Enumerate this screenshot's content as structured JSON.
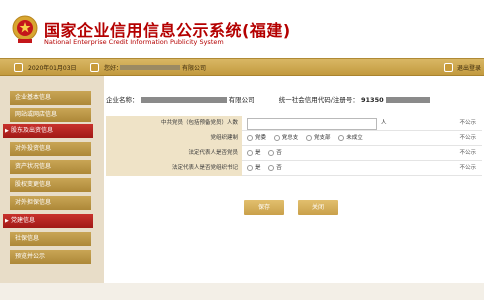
{
  "header": {
    "title_cn": "国家企业信用信息公示系统",
    "title_region": "(福建)",
    "title_en": "National Enterprise Credit Information Publicity System"
  },
  "toolbar": {
    "date": "2020年01月03日",
    "company_label": "您好：",
    "company_suffix": "有限公司",
    "logout": "退出登录"
  },
  "sidebar": {
    "items": [
      {
        "label": "企业基本信息",
        "active": false
      },
      {
        "label": "网站或网店信息",
        "active": false
      },
      {
        "label": "股东及出资信息",
        "active": true
      },
      {
        "label": "对外投资信息",
        "active": false
      },
      {
        "label": "资产状况信息",
        "active": false
      },
      {
        "label": "股权变更信息",
        "active": false
      },
      {
        "label": "对外担保信息",
        "active": false
      },
      {
        "label": "党建信息",
        "active": true
      },
      {
        "label": "社保信息",
        "active": false
      },
      {
        "label": "预览并公示",
        "active": false
      }
    ]
  },
  "main": {
    "company_name_label": "企业名称：",
    "company_name_suffix": "有限公司",
    "credit_code_label": "统一社会信用代码/注册号：",
    "credit_code_prefix": "91350",
    "rows": [
      {
        "label": "中共党员（包括预备党员）人数",
        "unit": "人",
        "public": "不公示"
      },
      {
        "label": "党组织建制",
        "options": [
          "党委",
          "党总支",
          "党支部",
          "未成立"
        ],
        "public": "不公示"
      },
      {
        "label": "法定代表人是否党员",
        "options": [
          "是",
          "否"
        ],
        "public": "不公示"
      },
      {
        "label": "法定代表人是否党组织书记",
        "options": [
          "是",
          "否"
        ],
        "public": "不公示"
      }
    ],
    "save_label": "保存",
    "close_label": "关闭"
  },
  "colors": {
    "brand_red": "#b40000",
    "gold": "#c9a04a",
    "active_red": "#a11916"
  }
}
